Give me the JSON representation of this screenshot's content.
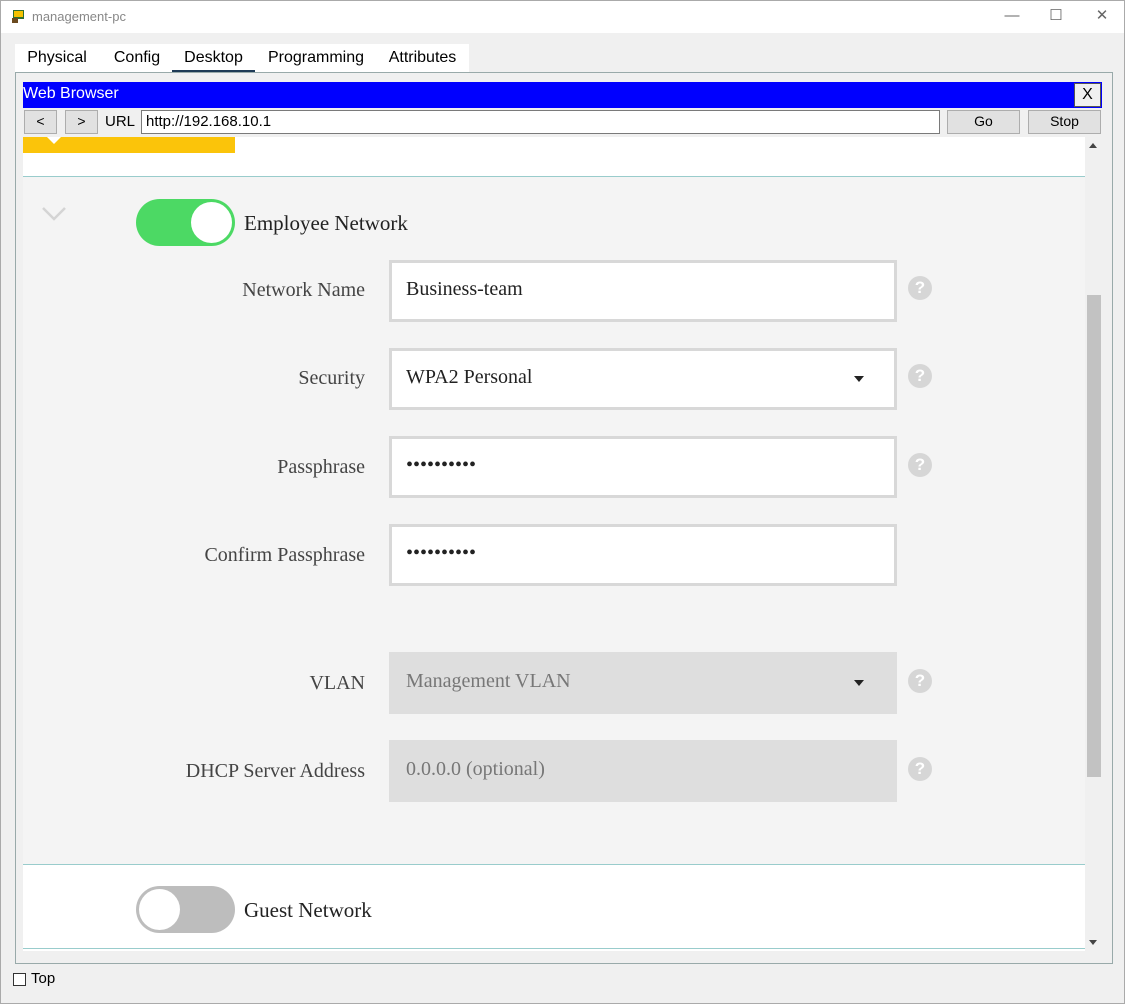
{
  "window": {
    "title": "management-pc",
    "controls": {
      "minimize": "—",
      "maximize": "☐",
      "close": "✕"
    }
  },
  "tabs": [
    {
      "label": "Physical"
    },
    {
      "label": "Config"
    },
    {
      "label": "Desktop",
      "active": true
    },
    {
      "label": "Programming"
    },
    {
      "label": "Attributes"
    }
  ],
  "browser": {
    "title": "Web Browser",
    "close_label": "X",
    "back_label": "<",
    "forward_label": ">",
    "url_label": "URL",
    "url": "http://192.168.10.1",
    "go_label": "Go",
    "stop_label": "Stop"
  },
  "employee_network": {
    "label": "Employee Network",
    "enabled": true,
    "fields": {
      "network_name": {
        "label": "Network Name",
        "value": "Business-team"
      },
      "security": {
        "label": "Security",
        "value": "WPA2 Personal"
      },
      "passphrase": {
        "label": "Passphrase",
        "value": "••••••••••"
      },
      "confirm_passphrase": {
        "label": "Confirm Passphrase",
        "value": "••••••••••"
      },
      "vlan": {
        "label": "VLAN",
        "value": "Management VLAN"
      },
      "dhcp_server": {
        "label": "DHCP Server Address",
        "placeholder": "0.0.0.0 (optional)"
      }
    },
    "help_glyph": "?"
  },
  "guest_network": {
    "label": "Guest Network",
    "enabled": false
  },
  "footer": {
    "top_label": "Top",
    "top_checked": false
  },
  "colors": {
    "title_bar_blue": "#0000ff",
    "accent_yellow": "#fbc40a",
    "toggle_on": "#4cd964",
    "toggle_off": "#bdbdbd"
  }
}
